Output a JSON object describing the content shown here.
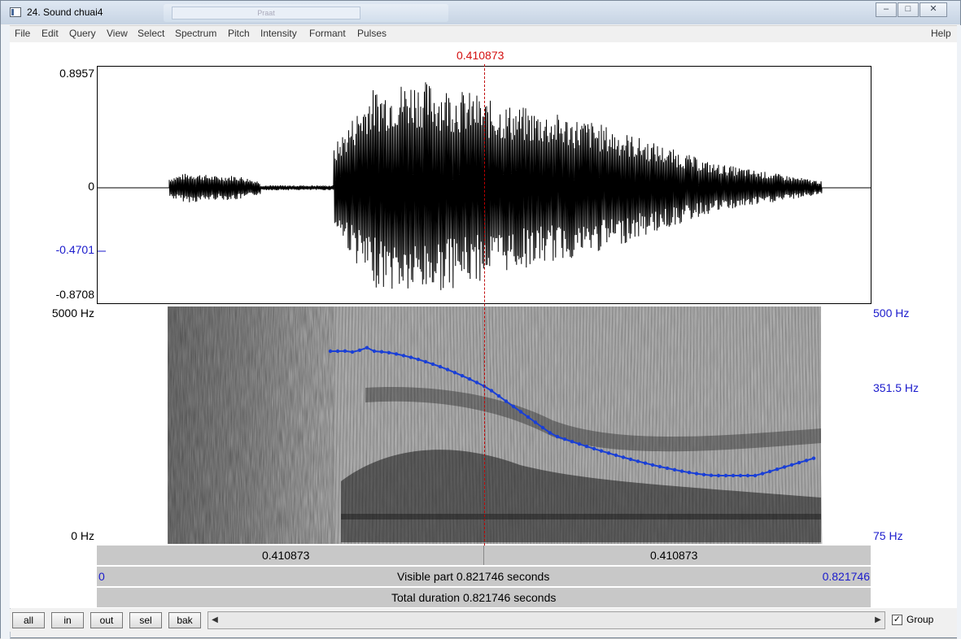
{
  "window": {
    "title": "24. Sound chuai4",
    "glass_text": "Praat"
  },
  "controls": {
    "minimize": "–",
    "maximize": "□",
    "close": "✕"
  },
  "menu": {
    "items": [
      "File",
      "Edit",
      "Query",
      "View",
      "Select",
      "Spectrum",
      "Pitch",
      "Intensity",
      "Formant",
      "Pulses"
    ],
    "help": "Help"
  },
  "waveform": {
    "cursor_time": "0.410873",
    "y_max": "0.8957",
    "y_zero": "0",
    "y_cursor": "-0.4701",
    "y_min": "-0.8708"
  },
  "spectrogram": {
    "freq_top": "5000 Hz",
    "freq_bottom": "0 Hz",
    "pitch_top": "500 Hz",
    "pitch_mid": "351.5 Hz",
    "pitch_bottom": "75 Hz"
  },
  "time_bars": {
    "left_segment": "0.410873",
    "right_segment": "0.410873",
    "visible_start": "0",
    "visible_label": "Visible part 0.821746 seconds",
    "visible_end": "0.821746",
    "total_label": "Total duration 0.821746 seconds"
  },
  "bottom": {
    "buttons": [
      "all",
      "in",
      "out",
      "sel",
      "bak"
    ],
    "scroll_left": "◀",
    "scroll_right": "▶",
    "group_label": "Group",
    "group_checked": "✓"
  },
  "colors": {
    "cursor": "#d41010",
    "axis_blue": "#1a1acc",
    "pitch": "#1a3fd6"
  }
}
